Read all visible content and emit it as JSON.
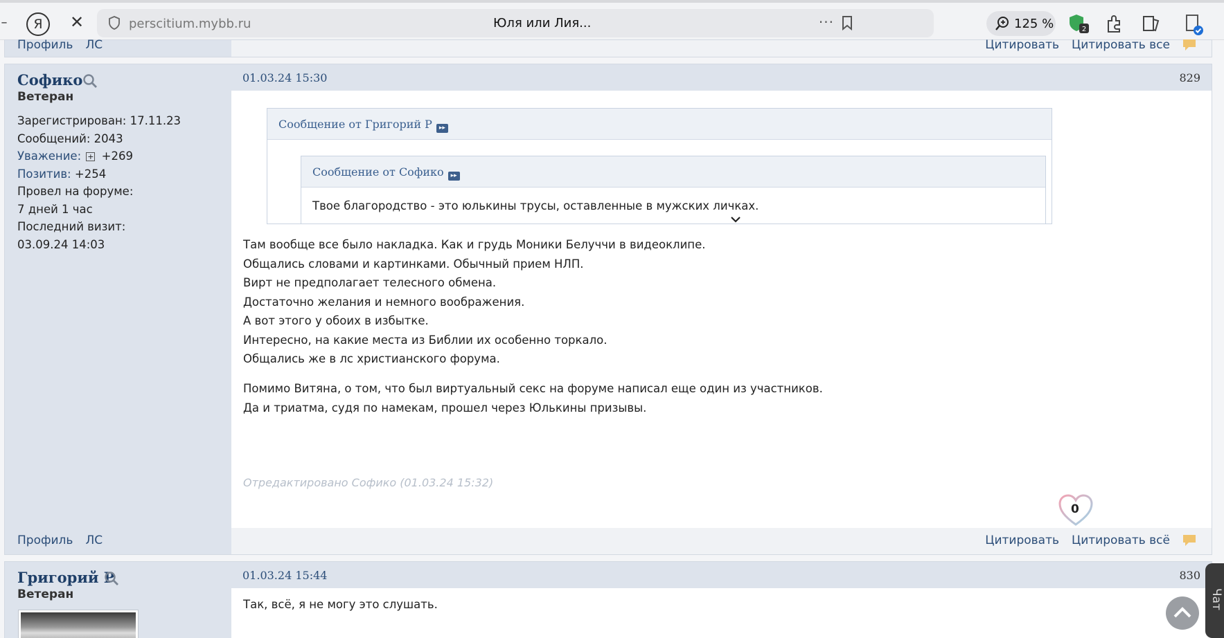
{
  "browser": {
    "back_glyph": "–",
    "yandex_glyph": "Я",
    "stop_glyph": "✕",
    "url": "perscitium.mybb.ru",
    "tab_title": "Юля или Лия...",
    "menu_dots": "···",
    "zoom": "125 %"
  },
  "prev_post": {
    "profile_label": "Профиль",
    "pm_label": "ЛС",
    "quote_label": "Цитировать",
    "quote_all_label": "Цитировать все"
  },
  "post1": {
    "author": "Софико",
    "rank": "Ветеран",
    "registered": "Зарегистрирован: 17.11.23",
    "messages": "Сообщений: 2043",
    "respect_label": "Уважение:",
    "respect_value": "+269",
    "positive_label": "Позитив:",
    "positive_value": "+254",
    "time_on_forum_label": "Провел на форуме:",
    "time_on_forum_value": "7 дней 1 час",
    "last_visit_label": "Последний визит:",
    "last_visit_value": "03.09.24 14:03",
    "date": "01.03.24 15:30",
    "number": "829",
    "outer_quote_head": "Сообщение от Григорий Р",
    "inner_quote_head": "Сообщение от Софико",
    "inner_quote_text": "Твое благородство - это юлькины трусы, оставленные в мужских личках.",
    "body_lines_1": [
      "Там вообще все было накладка. Как и грудь Моники Белуччи в видеоклипе.",
      "Общались словами и картинками. Обычный прием НЛП.",
      "Вирт не предполагает телесного обмена.",
      "Достаточно желания и немного воображения.",
      "А вот этого у обоих в избытке.",
      "Интересно, на какие места из Библии их особенно торкало.",
      "Общались же в лс христианского форума."
    ],
    "body_lines_2": [
      "Помимо Витяна, о том, что был виртуальный секс на форуме написал еще один из участников.",
      "Да и триатма, судя по намекам, прошел через Юлькины призывы."
    ],
    "edited": "Отредактировано Софико (01.03.24 15:32)",
    "likes": "0",
    "profile_label": "Профиль",
    "pm_label": "ЛС",
    "quote_label": "Цитировать",
    "quote_all_label": "Цитировать всё"
  },
  "post2": {
    "author": "Григорий Р",
    "rank": "Ветеран",
    "date": "01.03.24 15:44",
    "number": "830",
    "body": "Так, всё, я не могу это слушать."
  },
  "chat_label": "Чат",
  "colors": {
    "link": "#2b4d78",
    "sidebar_bg": "#dde3ec",
    "quote_head_bg": "#edf1f6",
    "report_icon": "#f0c36d"
  }
}
